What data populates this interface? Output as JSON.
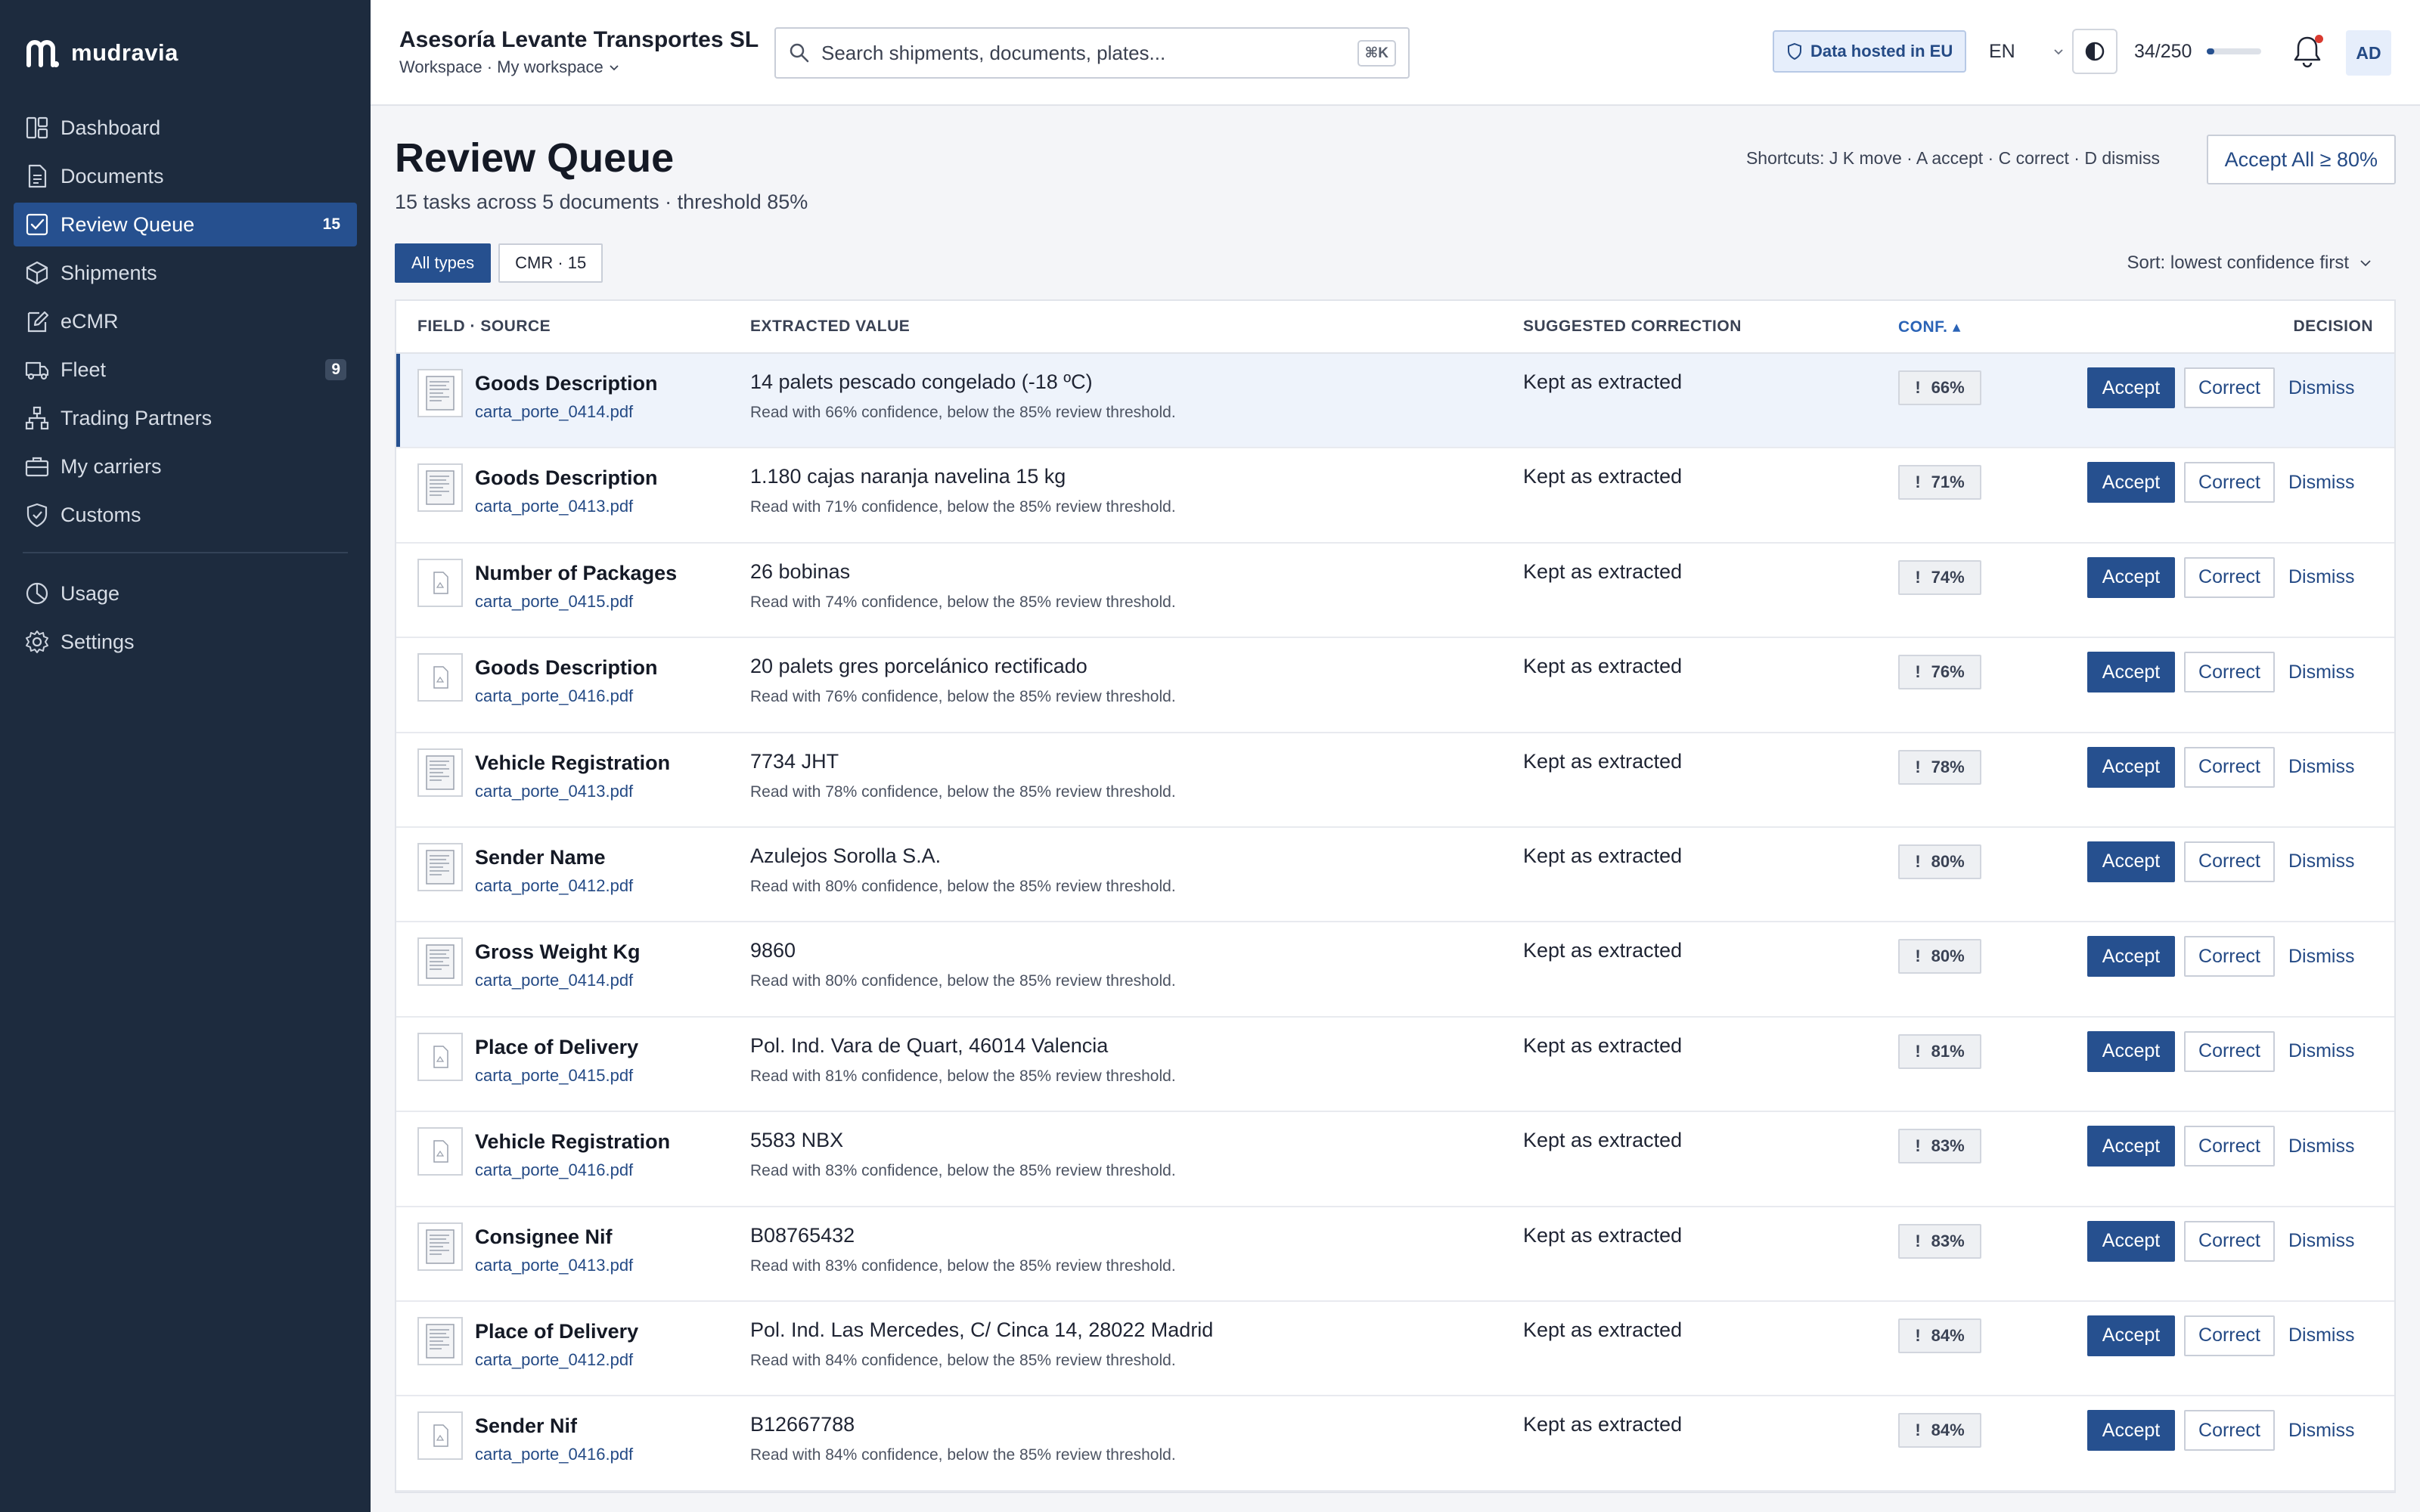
{
  "brand": {
    "name": "mudravia",
    "icon": "mudravia-logo"
  },
  "sidebar": {
    "items": [
      {
        "label": "Dashboard",
        "icon": "dashboard-icon",
        "count": ""
      },
      {
        "label": "Documents",
        "icon": "document-icon",
        "count": ""
      },
      {
        "label": "Review Queue",
        "icon": "check-square-icon",
        "count": "15",
        "active": true
      },
      {
        "label": "Shipments",
        "icon": "box-icon",
        "count": ""
      },
      {
        "label": "eCMR",
        "icon": "edit-doc-icon",
        "count": ""
      },
      {
        "label": "Fleet",
        "icon": "truck-icon",
        "count": "9"
      },
      {
        "label": "Trading Partners",
        "icon": "network-icon",
        "count": ""
      },
      {
        "label": "My carriers",
        "icon": "briefcase-icon",
        "count": ""
      },
      {
        "label": "Customs",
        "icon": "shield-icon",
        "count": ""
      }
    ],
    "secondary": [
      {
        "label": "Usage",
        "icon": "pie-chart-icon"
      },
      {
        "label": "Settings",
        "icon": "gear-icon"
      }
    ]
  },
  "topbar": {
    "org_name": "Asesoría Levante Transportes SL",
    "org_sub": "Workspace · My workspace",
    "search_placeholder": "Search shipments, documents, plates...",
    "search_shortcut": "⌘K",
    "eu_badge": "Data hosted in EU",
    "language": "EN",
    "usage": "34/250",
    "usage_fraction": 0.136,
    "avatar": "AD"
  },
  "page": {
    "title": "Review Queue",
    "subtitle": "15 tasks across 5 documents · threshold 85%",
    "shortcuts": "Shortcuts: J K move · A accept · C correct · D dismiss",
    "accept_all": "Accept All ≥ 80%",
    "filters": [
      "All types",
      "CMR · 15"
    ],
    "sort": "Sort: lowest confidence first"
  },
  "table": {
    "headers": {
      "field": "FIELD · SOURCE",
      "extracted": "EXTRACTED VALUE",
      "suggest": "SUGGESTED CORRECTION",
      "conf": "CONF. ▴",
      "decision": "DECISION"
    },
    "actions": {
      "accept": "Accept",
      "correct": "Correct",
      "dismiss": "Dismiss"
    },
    "rows": [
      {
        "field": "Goods Description",
        "source": "carta_porte_0414.pdf",
        "value": "14 palets pescado congelado (-18 ºC)",
        "note": "Read with 66% confidence, below the 85% review threshold.",
        "suggestion": "Kept as extracted",
        "conf": "66%"
      },
      {
        "field": "Goods Description",
        "source": "carta_porte_0413.pdf",
        "value": "1.180 cajas naranja navelina 15 kg",
        "note": "Read with 71% confidence, below the 85% review threshold.",
        "suggestion": "Kept as extracted",
        "conf": "71%"
      },
      {
        "field": "Number of Packages",
        "source": "carta_porte_0415.pdf",
        "value": "26 bobinas",
        "note": "Read with 74% confidence, below the 85% review threshold.",
        "suggestion": "Kept as extracted",
        "conf": "74%"
      },
      {
        "field": "Goods Description",
        "source": "carta_porte_0416.pdf",
        "value": "20 palets gres porcelánico rectificado",
        "note": "Read with 76% confidence, below the 85% review threshold.",
        "suggestion": "Kept as extracted",
        "conf": "76%"
      },
      {
        "field": "Vehicle Registration",
        "source": "carta_porte_0413.pdf",
        "value": "7734 JHT",
        "note": "Read with 78% confidence, below the 85% review threshold.",
        "suggestion": "Kept as extracted",
        "conf": "78%"
      },
      {
        "field": "Sender Name",
        "source": "carta_porte_0412.pdf",
        "value": "Azulejos Sorolla S.A.",
        "note": "Read with 80% confidence, below the 85% review threshold.",
        "suggestion": "Kept as extracted",
        "conf": "80%"
      },
      {
        "field": "Gross Weight Kg",
        "source": "carta_porte_0414.pdf",
        "value": "9860",
        "note": "Read with 80% confidence, below the 85% review threshold.",
        "suggestion": "Kept as extracted",
        "conf": "80%"
      },
      {
        "field": "Place of Delivery",
        "source": "carta_porte_0415.pdf",
        "value": "Pol. Ind. Vara de Quart, 46014 Valencia",
        "note": "Read with 81% confidence, below the 85% review threshold.",
        "suggestion": "Kept as extracted",
        "conf": "81%"
      },
      {
        "field": "Vehicle Registration",
        "source": "carta_porte_0416.pdf",
        "value": "5583 NBX",
        "note": "Read with 83% confidence, below the 85% review threshold.",
        "suggestion": "Kept as extracted",
        "conf": "83%"
      },
      {
        "field": "Consignee Nif",
        "source": "carta_porte_0413.pdf",
        "value": "B08765432",
        "note": "Read with 83% confidence, below the 85% review threshold.",
        "suggestion": "Kept as extracted",
        "conf": "83%"
      },
      {
        "field": "Place of Delivery",
        "source": "carta_porte_0412.pdf",
        "value": "Pol. Ind. Las Mercedes, C/ Cinca 14, 28022 Madrid",
        "note": "Read with 84% confidence, below the 85% review threshold.",
        "suggestion": "Kept as extracted",
        "conf": "84%"
      },
      {
        "field": "Sender Nif",
        "source": "carta_porte_0416.pdf",
        "value": "B12667788",
        "note": "Read with 84% confidence, below the 85% review threshold.",
        "suggestion": "Kept as extracted",
        "conf": "84%"
      }
    ]
  },
  "colors": {
    "sidebar": "#1d2b3e",
    "accent": "#26508f",
    "link": "#244a85",
    "notification": "#d93a2f"
  }
}
